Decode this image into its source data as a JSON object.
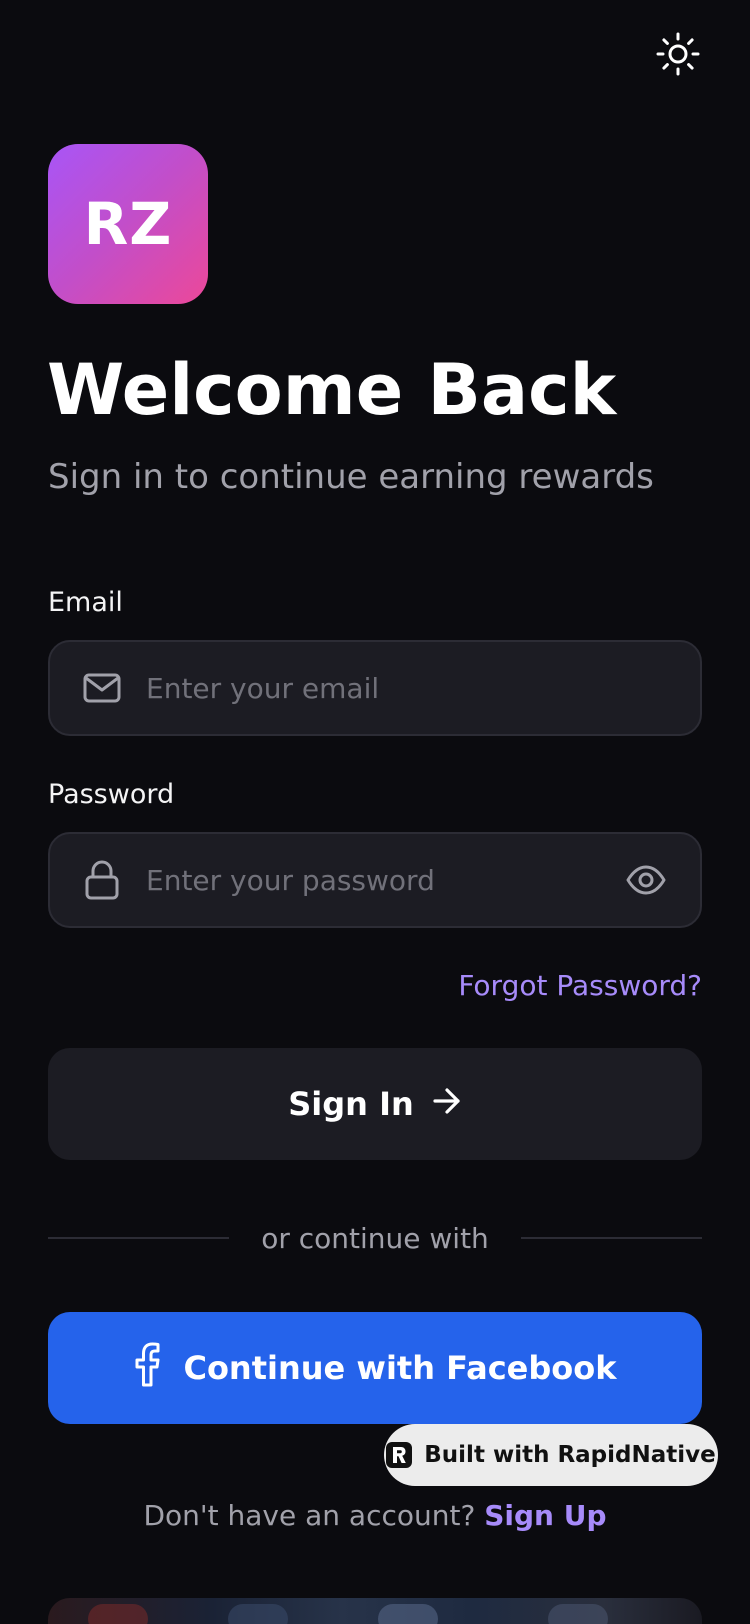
{
  "header": {
    "theme_toggle_icon": "sun-icon"
  },
  "brand": {
    "logo_text": "RZ",
    "gradient_start": "#a855f7",
    "gradient_end": "#ec4899"
  },
  "heading": {
    "title": "Welcome Back",
    "subtitle": "Sign in to continue earning rewards"
  },
  "form": {
    "email": {
      "label": "Email",
      "placeholder": "Enter your email",
      "value": "",
      "icon": "mail-icon"
    },
    "password": {
      "label": "Password",
      "placeholder": "Enter your password",
      "value": "",
      "icon": "lock-icon",
      "toggle_icon": "eye-icon"
    },
    "forgot_label": "Forgot Password?",
    "submit_label": "Sign In",
    "submit_icon": "arrow-right-icon"
  },
  "divider": {
    "text": "or continue with"
  },
  "social": {
    "facebook_label": "Continue with Facebook",
    "facebook_color": "#2563eb",
    "icon": "facebook-icon"
  },
  "badge": {
    "label": "Built with RapidNative"
  },
  "footer": {
    "prompt": "Don't have an account?",
    "signup_label": "Sign Up"
  },
  "colors": {
    "background": "#0b0b0f",
    "surface": "#1c1c23",
    "accent": "#a78bfa",
    "muted": "#a1a1aa"
  }
}
